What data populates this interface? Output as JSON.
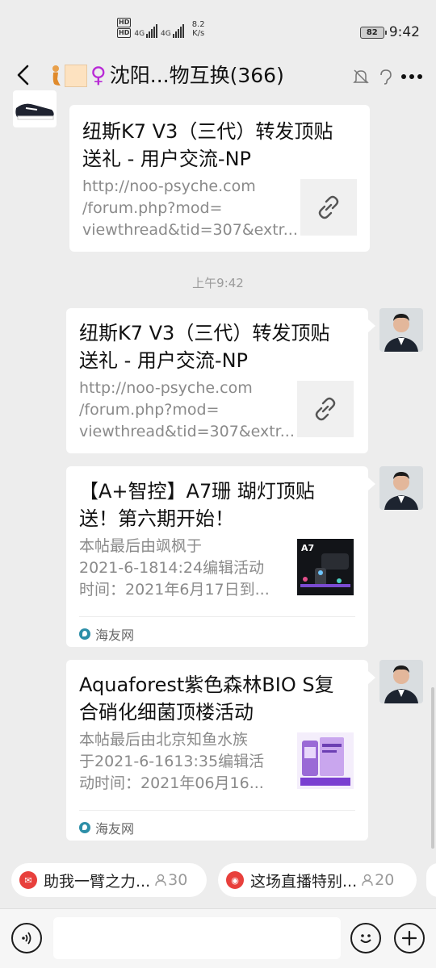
{
  "status_bar": {
    "hd1": "HD",
    "hd2": "HD",
    "net1": "4G",
    "net2": "4G",
    "speed_value": "8.2",
    "speed_unit": "K/s",
    "battery": "82",
    "time": "9:42"
  },
  "header": {
    "title": "沈阳...物互换(366)"
  },
  "messages": [
    {
      "title": "纽斯K7 V3（三代）转发顶贴送礼 - 用户交流-NP",
      "title_line1": "纽斯K7 V3（三代）转发顶贴",
      "title_line2": "送礼 - 用户交流-NP",
      "desc": "http://noo-psyche.com\n/forum.php?mod=\nviewthread&tid=307&extr...",
      "thumb": "link-icon"
    },
    {
      "title_line1": "纽斯K7 V3（三代）转发顶贴",
      "title_line2": "送礼 - 用户交流-NP",
      "desc": "http://noo-psyche.com\n/forum.php?mod=\nviewthread&tid=307&extr...",
      "thumb": "link-icon"
    },
    {
      "title_line1": "【A+智控】A7珊 瑚灯顶贴",
      "title_line2": "送！第六期开始！",
      "desc": "本帖最后由飒枫于\n2021-6-1814:24编辑活动\n时间：2021年6月17日到...",
      "thumb_label": "A7",
      "source": "海友网"
    },
    {
      "title_line1": "Aquaforest紫色森林BIO S复",
      "title_line2": "合硝化细菌顶楼活动",
      "desc": "本帖最后由北京知鱼水族\n于2021-6-1613:35编辑活\n动时间：2021年06月16...",
      "source": "海友网"
    }
  ],
  "timestamp": "上午9:42",
  "chips": [
    {
      "label": "助我一臂之力...",
      "count": "30"
    },
    {
      "label": "这场直播特别...",
      "count": "20"
    }
  ],
  "input": {
    "value": ""
  },
  "colors": {
    "background": "#ededed",
    "card": "#ffffff",
    "link_gray": "#8a8a8a",
    "chip_red": "#e8403c"
  }
}
